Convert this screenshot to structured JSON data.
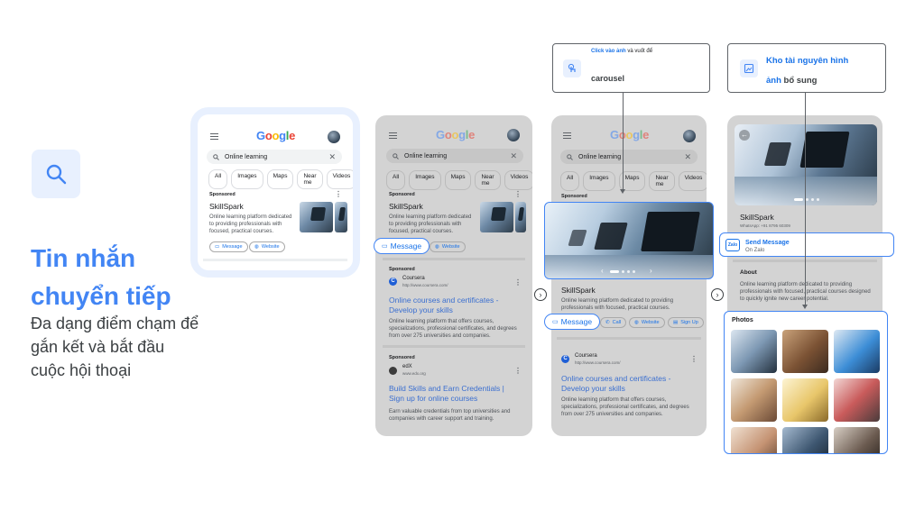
{
  "left": {
    "headline": "Tin nhắn chuyển tiếp",
    "subline": "Đa dạng điểm chạm để gắn kết và bắt đầu cuộc hội thoại",
    "icon": "search-icon"
  },
  "google_logo": [
    "G",
    "o",
    "o",
    "g",
    "l",
    "e"
  ],
  "search_query": "Online learning",
  "chips": [
    "All",
    "Images",
    "Maps",
    "Near me",
    "Videos"
  ],
  "ad": {
    "sponsored": "Sponsored",
    "name": "SkillSpark",
    "desc": "Online learning platform dedicated to providing professionals with focused, practical courses.",
    "message": "Message",
    "website": "Website",
    "call": "Call",
    "signup": "Sign Up"
  },
  "coursera": {
    "sponsored": "Sponsored",
    "name": "Coursera",
    "url": "http://www.coursera.com/",
    "title": "Online courses and certificates - Develop your skills",
    "desc": "Online learning platform that offers courses, specializations, professional certificates, and degrees from over 275 universities and companies."
  },
  "edx": {
    "sponsored": "Sponsored",
    "name": "edX",
    "url": "www.edx.org",
    "title": "Build Skills and Earn Credentials | Sign up for online courses",
    "desc": "Earn valuable credentials from top universities and companies with career support and training."
  },
  "callout1": {
    "line1_blue": "Click vào ảnh",
    "line1_rest": " và vuốt để",
    "line2": "carousel"
  },
  "callout2": {
    "line1": "Kho tài nguyên hình",
    "line2_blue": "ảnh",
    "line2_rest": " bổ sung"
  },
  "detail": {
    "name": "SkillSpark",
    "phone": "WhatsApp: +91 8795 60309",
    "zalo_label": "Zalo",
    "send": "Send Message",
    "on": "On Zalo",
    "about_h": "About",
    "about": "Online learning platform dedicated to providing professionals with focused, practical courses designed to quickly ignite new career potential.",
    "photos": "Photos"
  },
  "colors": {
    "accent": "#4285f4",
    "accent_bg": "#e8f0fe",
    "gray_phone": "#d3d3d3"
  }
}
